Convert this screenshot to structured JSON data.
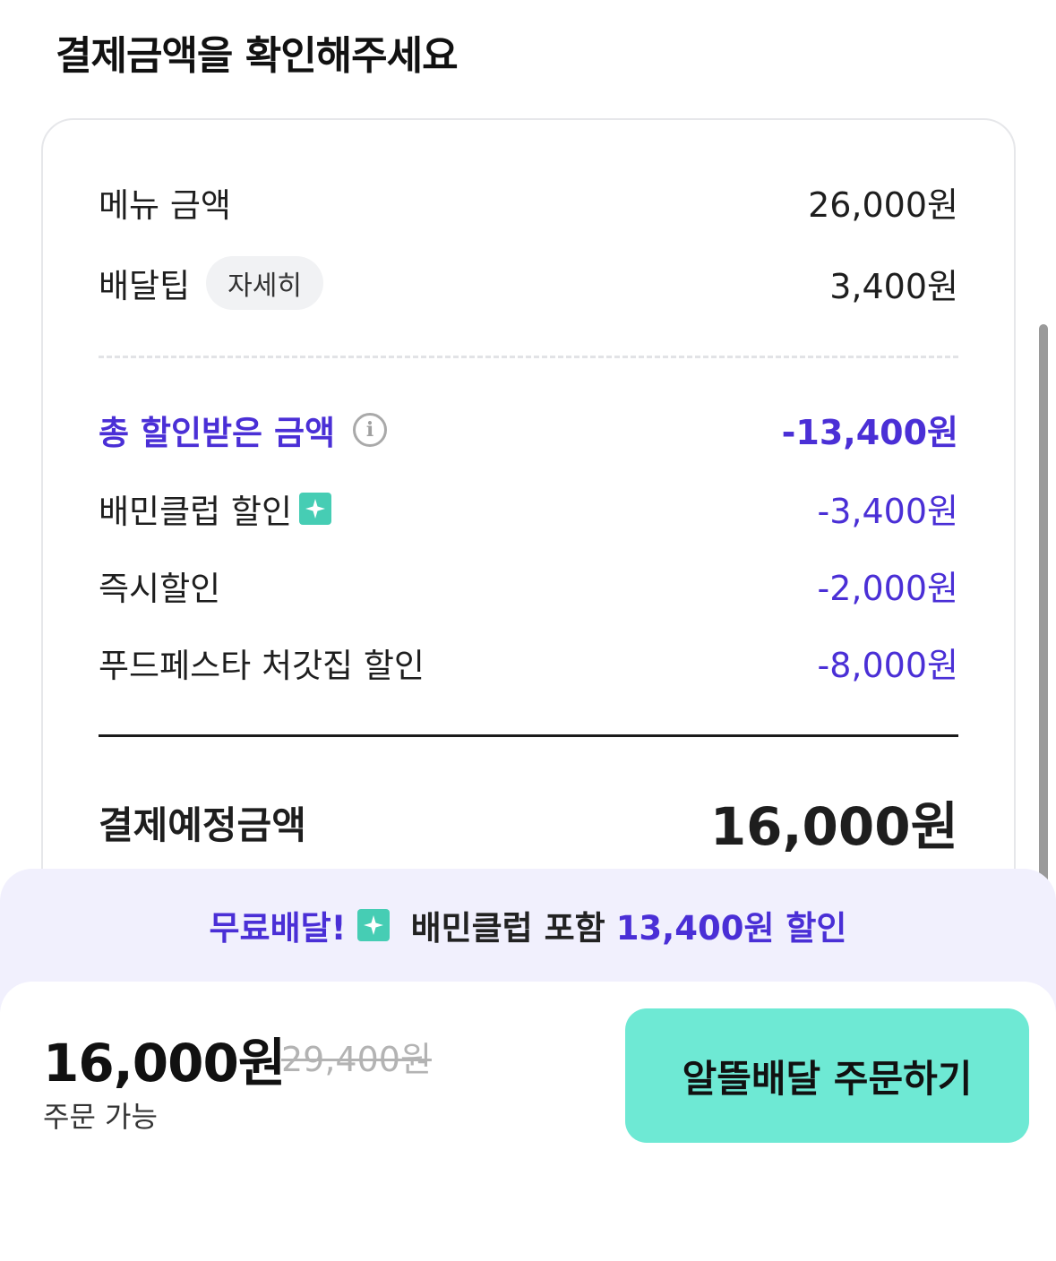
{
  "header": {
    "title": "결제금액을 확인해주세요"
  },
  "summary": {
    "menu_label": "메뉴 금액",
    "menu_value": "26,000원",
    "delivery_label": "배달팁",
    "delivery_detail_chip": "자세히",
    "delivery_value": "3,400원",
    "total_discount_label": "총 할인받은 금액",
    "total_discount_value": "-13,400원",
    "discounts": [
      {
        "label": "배민클럽 할인",
        "value": "-3,400원",
        "icon": "sparkle-badge-icon"
      },
      {
        "label": "즉시할인",
        "value": "-2,000원"
      },
      {
        "label": "푸드페스타 처갓집 할인",
        "value": "-8,000원"
      }
    ],
    "payment_label": "결제예정금액",
    "payment_value": "16,000원"
  },
  "promo": {
    "free_delivery": "무료배달!",
    "club_text": "배민클럽 포함",
    "discount_text": "13,400원 할인"
  },
  "footer": {
    "final_price": "16,000원",
    "original_price": "29,400원",
    "status": "주문 가능",
    "order_button": "알뜰배달 주문하기"
  },
  "colors": {
    "accent_purple": "#4a2fd6",
    "mint_button": "#6ee9d4",
    "promo_bg": "#f1f0fd",
    "badge_teal": "#46cdb4"
  }
}
